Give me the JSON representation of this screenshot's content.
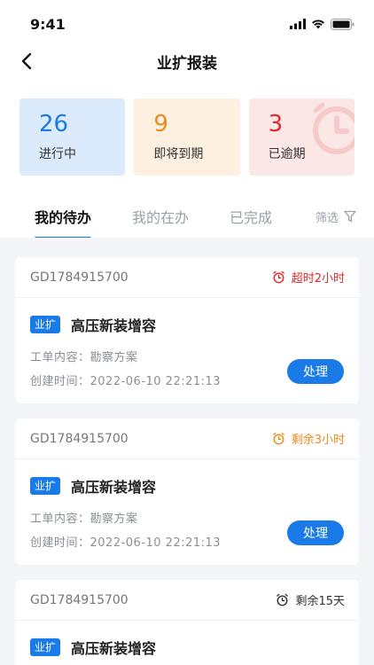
{
  "status": {
    "time": "9:41"
  },
  "nav": {
    "title": "业扩报装"
  },
  "stats": [
    {
      "value": "26",
      "label": "进行中"
    },
    {
      "value": "9",
      "label": "即将到期"
    },
    {
      "value": "3",
      "label": "已逾期"
    }
  ],
  "tabs": [
    {
      "label": "我的待办"
    },
    {
      "label": "我的在办"
    },
    {
      "label": "已完成"
    }
  ],
  "filter": {
    "label": "筛选"
  },
  "orders": [
    {
      "id": "GD1784915700",
      "timer": "超时2小时",
      "badge": "业扩",
      "title": "高压新装增容",
      "content": "工单内容：勘察方案",
      "created": "创建时间：2022-06-10 22:21:13",
      "action": "处理"
    },
    {
      "id": "GD1784915700",
      "timer": "剩余3小时",
      "badge": "业扩",
      "title": "高压新装增容",
      "content": "工单内容：勘察方案",
      "created": "创建时间：2022-06-10 22:21:13",
      "action": "处理"
    },
    {
      "id": "GD1784915700",
      "timer": "剩余15天",
      "badge": "业扩",
      "title": "高压新装增容"
    }
  ],
  "colors": {
    "accent": "#1a7be8",
    "overdue": "#dd2b2b",
    "warning": "#ee8a1b"
  }
}
